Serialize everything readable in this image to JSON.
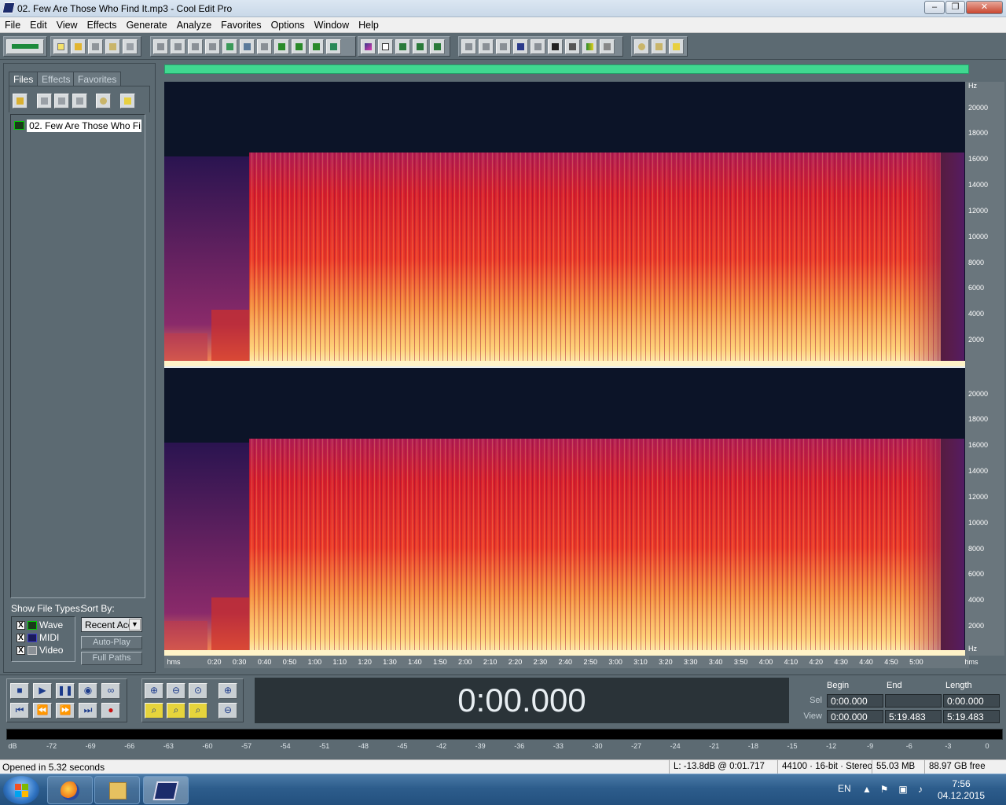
{
  "window": {
    "title": "02. Few Are Those Who Find It.mp3 - Cool Edit Pro",
    "controls": {
      "minimize": "–",
      "restore": "❐",
      "close": "✕"
    }
  },
  "menu": [
    "File",
    "Edit",
    "View",
    "Effects",
    "Generate",
    "Analyze",
    "Favorites",
    "Options",
    "Window",
    "Help"
  ],
  "left_panel": {
    "tabs": [
      "Files",
      "Effects",
      "Favorites"
    ],
    "file_entry": "02. Few Are Those Who Fi...",
    "show_file_types_label": "Show File Types:",
    "sort_by_label": "Sort By:",
    "file_types": [
      {
        "label": "Wave",
        "checked": "X"
      },
      {
        "label": "MIDI",
        "checked": "X"
      },
      {
        "label": "Video",
        "checked": "X"
      }
    ],
    "sort_value": "Recent Acc",
    "auto_play": "Auto-Play",
    "full_paths": "Full Paths"
  },
  "spectrogram": {
    "freq_unit": "Hz",
    "freq_ticks": [
      "20000",
      "18000",
      "16000",
      "14000",
      "12000",
      "10000",
      "8000",
      "6000",
      "4000",
      "2000"
    ],
    "time_unit": "hms",
    "time_ticks": [
      "0:20",
      "0:30",
      "0:40",
      "0:50",
      "1:00",
      "1:10",
      "1:20",
      "1:30",
      "1:40",
      "1:50",
      "2:00",
      "2:10",
      "2:20",
      "2:30",
      "2:40",
      "2:50",
      "3:00",
      "3:10",
      "3:20",
      "3:30",
      "3:40",
      "3:50",
      "4:00",
      "4:10",
      "4:20",
      "4:30",
      "4:40",
      "4:50",
      "5:00"
    ],
    "colors": {
      "background": "#0c1428",
      "low": "#4a1d6a",
      "mid": "#e8202a",
      "high": "#ffe08a"
    }
  },
  "time_display": "0:00.000",
  "selview": {
    "headers": {
      "begin": "Begin",
      "end": "End",
      "length": "Length"
    },
    "sel": {
      "label": "Sel",
      "begin": "0:00.000",
      "end": "",
      "length": "0:00.000"
    },
    "view": {
      "label": "View",
      "begin": "0:00.000",
      "end": "5:19.483",
      "length": "5:19.483"
    }
  },
  "meter_scale": [
    "dB",
    "-72",
    "-69",
    "-66",
    "-63",
    "-60",
    "-57",
    "-54",
    "-51",
    "-48",
    "-45",
    "-42",
    "-39",
    "-36",
    "-33",
    "-30",
    "-27",
    "-24",
    "-21",
    "-18",
    "-15",
    "-12",
    "-9",
    "-6",
    "-3",
    "0"
  ],
  "status": {
    "message": "Opened in 5.32 seconds",
    "level": "L: -13.8dB @  0:01.717",
    "format": "44100 · 16-bit · Stereo",
    "size": "55.03 MB",
    "free": "88.97 GB free"
  },
  "taskbar": {
    "lang": "EN",
    "time": "7:56",
    "date": "04.12.2015"
  }
}
